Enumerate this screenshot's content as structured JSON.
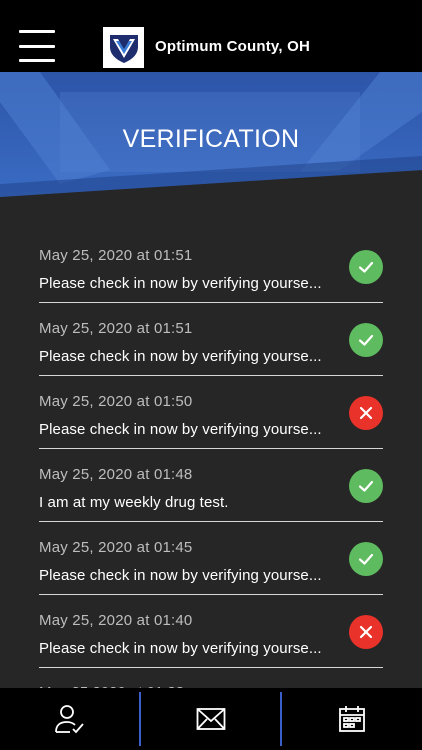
{
  "header": {
    "title": "Optimum County, OH",
    "menu_icon": "hamburger-menu-icon",
    "logo_icon": "shield-logo-icon"
  },
  "banner": {
    "title": "VERIFICATION"
  },
  "colors": {
    "success": "#5fbb5f",
    "failure": "#e8322a",
    "banner_blue": "#3569c0",
    "tab_divider": "#3a5fc8"
  },
  "verifications": [
    {
      "date": "May 25, 2020 at 01:51",
      "message": "Please check in now by verifying yourse...",
      "status": "success"
    },
    {
      "date": "May 25, 2020 at 01:51",
      "message": "Please check in now by verifying yourse...",
      "status": "success"
    },
    {
      "date": "May 25, 2020 at 01:50",
      "message": "Please check in now by verifying yourse...",
      "status": "failure"
    },
    {
      "date": "May 25, 2020 at 01:48",
      "message": "I am at my weekly drug test.",
      "status": "success"
    },
    {
      "date": "May 25, 2020 at 01:45",
      "message": "Please check in now by verifying yourse...",
      "status": "success"
    },
    {
      "date": "May 25, 2020 at 01:40",
      "message": "Please check in now by verifying yourse...",
      "status": "failure"
    }
  ],
  "tabs": [
    {
      "icon": "user-check-icon"
    },
    {
      "icon": "envelope-icon"
    },
    {
      "icon": "calendar-icon"
    }
  ]
}
